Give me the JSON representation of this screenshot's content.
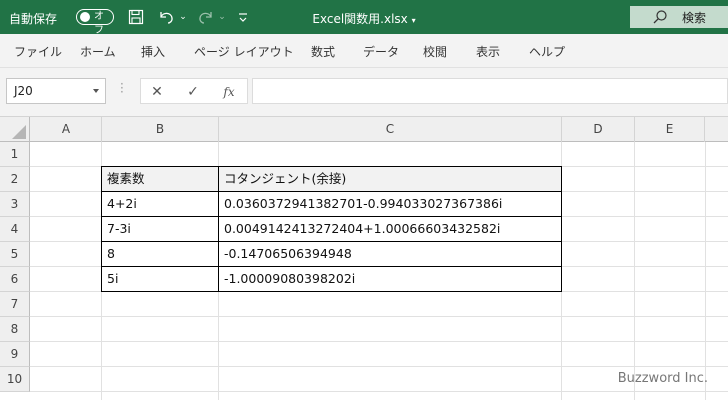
{
  "titlebar": {
    "autosave_label": "自動保存",
    "autosave_state": "オフ",
    "filename": "Excel関数用.xlsx",
    "search_label": "検索",
    "icons": [
      "save-icon",
      "undo-icon",
      "redo-icon",
      "customize-icon",
      "search-icon"
    ]
  },
  "ribbon": {
    "tabs": [
      "ファイル",
      "ホーム",
      "挿入",
      "ページ レイアウト",
      "数式",
      "データ",
      "校閲",
      "表示",
      "ヘルプ"
    ]
  },
  "formula_bar": {
    "name_box": "J20",
    "cancel_symbol": "✕",
    "enter_symbol": "✓",
    "fx_symbol": "fx",
    "formula": ""
  },
  "sheet": {
    "columns": [
      "A",
      "B",
      "C",
      "D",
      "E"
    ],
    "rows": [
      "1",
      "2",
      "3",
      "4",
      "5",
      "6",
      "7",
      "8",
      "9",
      "10"
    ],
    "table": [
      [
        "複素数",
        "コタンジェント(余接)"
      ],
      [
        "4+2i",
        "0.0360372941382701-0.994033027367386i"
      ],
      [
        "7-3i",
        "0.0049142413272404+1.00066603432582i"
      ],
      [
        "8",
        "-0.14706506394948"
      ],
      [
        "5i",
        "-1.00009080398202i"
      ]
    ]
  },
  "watermark": "Buzzword Inc.",
  "colors": {
    "titlebar": "#217346",
    "header_fill": "#f2f2f2"
  }
}
